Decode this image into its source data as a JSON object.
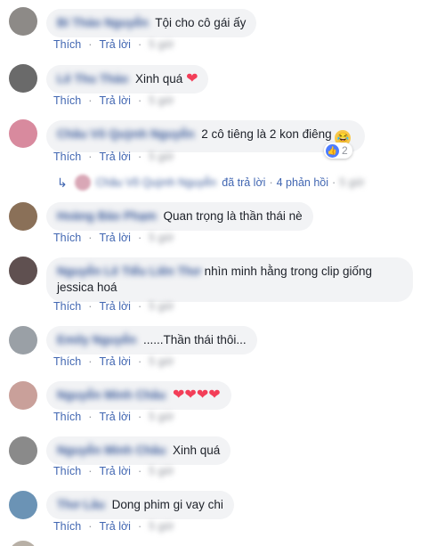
{
  "actions": {
    "like": "Thích",
    "reply": "Trả lời",
    "separator": "·"
  },
  "comments": [
    {
      "author": "Bí Thảo Nguyễn",
      "text": "Tội cho cô gái ấy",
      "time": "5 giờ",
      "avatar_color": "#8d8a87"
    },
    {
      "author": "Lê Thu Thảo",
      "text": "Xinh quá",
      "hearts": "❤",
      "time": "5 giờ",
      "avatar_color": "#6a6a6a"
    },
    {
      "author": "Châu Võ Quỳnh Nguyễn",
      "text": "2 cô tiêng là 2 kon điêng",
      "emoji": "😂",
      "time": "5 giờ",
      "avatar_color": "#d88a9e",
      "reaction_count": "2"
    },
    {
      "author": "Hoàng Bảo Phạm",
      "text": "Quan trọng là thần thái nè",
      "time": "5 giờ",
      "avatar_color": "#8a7058"
    },
    {
      "author": "Nguyễn Lê Tiểu Liên Thơ",
      "text": "nhìn minh hằng trong clip giống jessica hoá",
      "time": "5 giờ",
      "avatar_color": "#5f5050"
    },
    {
      "author": "Emily Nguyễn",
      "text": "......Thần thái thôi...",
      "time": "5 giờ",
      "avatar_color": "#9aa0a6"
    },
    {
      "author": "Nguyễn Minh Châu",
      "text": "",
      "hearts": "❤❤❤❤",
      "time": "5 giờ",
      "avatar_color": "#c9a09a"
    },
    {
      "author": "Nguyễn Minh Châu",
      "text": "Xinh quá",
      "time": "5 giờ",
      "avatar_color": "#8a8a8a"
    },
    {
      "author": "Thơ Lâu",
      "text": "Dong phim gi vay chi",
      "time": "5 giờ",
      "avatar_color": "#6b93b5"
    }
  ],
  "reply_summary": {
    "author": "Châu Võ Quỳnh Nguyễn",
    "replied": "đã trả lời",
    "dot": "·",
    "count": "4 phản hồi",
    "time": "5 giờ"
  }
}
